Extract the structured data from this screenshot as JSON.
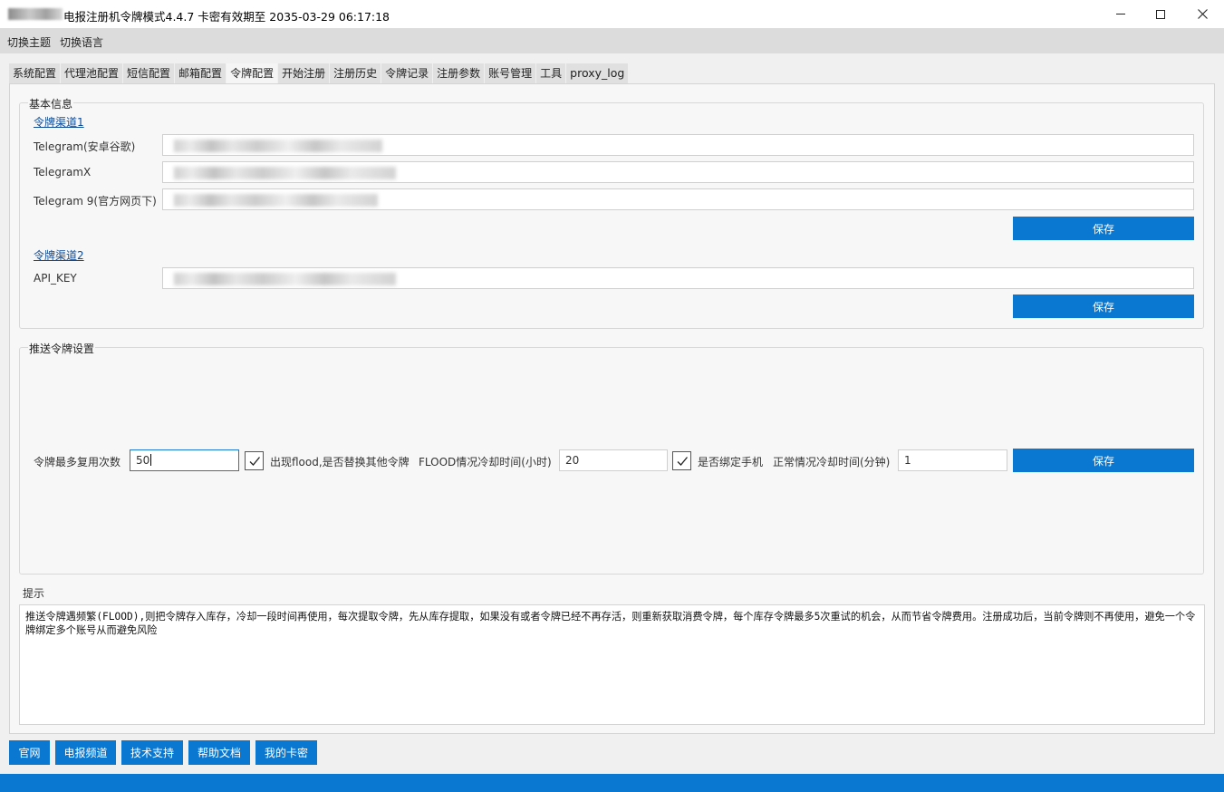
{
  "window": {
    "title": "电报注册机令牌模式4.4.7 卡密有效期至 2035-03-29 06:17:18",
    "min_icon": "minimize-icon",
    "max_icon": "maximize-icon",
    "close_icon": "close-icon"
  },
  "menu": {
    "items": [
      "切换主题",
      "切换语言"
    ]
  },
  "tabs": [
    "系统配置",
    "代理池配置",
    "短信配置",
    "邮箱配置",
    "令牌配置",
    "开始注册",
    "注册历史",
    "令牌记录",
    "注册参数",
    "账号管理",
    "工具",
    "proxy_log"
  ],
  "active_tab": "令牌配置",
  "basic": {
    "title": "基本信息",
    "channel1": {
      "link": "令牌渠道1",
      "rows": [
        {
          "label": "Telegram(安卓谷歌)"
        },
        {
          "label": "TelegramX"
        },
        {
          "label": "Telegram 9(官方网页下)"
        }
      ],
      "save": "保存"
    },
    "channel2": {
      "link": "令牌渠道2",
      "rows": [
        {
          "label": "API_KEY"
        }
      ],
      "save": "保存"
    }
  },
  "push": {
    "title": "推送令牌设置",
    "max_reuse_label": "令牌最多复用次数",
    "max_reuse_value": "50",
    "flood_replace_checked": true,
    "flood_replace_label": "出现flood,是否替换其他令牌",
    "flood_cooldown_label": "FLOOD情况冷却时间(小时)",
    "flood_cooldown_value": "20",
    "bind_phone_checked": true,
    "bind_phone_label": "是否绑定手机",
    "normal_cooldown_label": "正常情况冷却时间(分钟)",
    "normal_cooldown_value": "1",
    "save": "保存"
  },
  "hint": {
    "title": "提示",
    "text": "推送令牌遇频繁(FLOOD),则把令牌存入库存，冷却一段时间再使用，每次提取令牌，先从库存提取，如果没有或者令牌已经不再存活，则重新获取消费令牌，每个库存令牌最多5次重试的机会，从而节省令牌费用。注册成功后，当前令牌则不再使用，避免一个令牌绑定多个账号从而避免风险"
  },
  "bottom_buttons": [
    "官网",
    "电报频道",
    "技术支持",
    "帮助文档",
    "我的卡密"
  ],
  "colors": {
    "accent": "#0a78d0",
    "link": "#0f4c98"
  }
}
